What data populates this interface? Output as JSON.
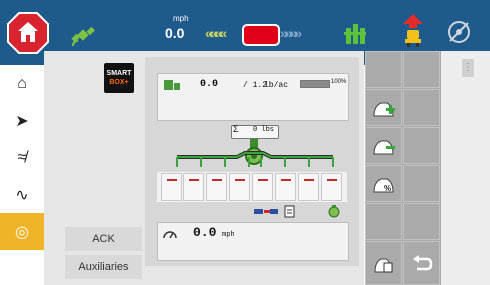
{
  "top_bar": {
    "speed_unit": "mph",
    "speed_value": "0.0",
    "steer_left": "««««",
    "steer_right": "»»»»",
    "icons": [
      "home-icon",
      "gps-satellite-icon",
      "boom-icon",
      "operator-seat-icon",
      "steering-wheel-disabled-icon"
    ],
    "colors": {
      "bar": "#1f5a8c",
      "home": "#d9232e",
      "alert": "#e0001a"
    }
  },
  "sidebar": {
    "items": [
      {
        "name": "home",
        "icon": "⌂"
      },
      {
        "name": "run",
        "icon": "➤"
      },
      {
        "name": "field",
        "icon": "≉"
      },
      {
        "name": "signal",
        "icon": "∿"
      },
      {
        "name": "settings",
        "icon": "◎"
      }
    ],
    "active_color": "#f0b428"
  },
  "smartbox": {
    "line1": "SMART",
    "line2": "BOX+"
  },
  "rate": {
    "value": "0.0",
    "target": "/ 1.2",
    "unit": "lb/ac",
    "tank_percent": "100%"
  },
  "total": {
    "sigma": "Σ",
    "value": "0 lbs"
  },
  "sections": {
    "count": 8
  },
  "speed": {
    "value": "0.0",
    "unit": "mph"
  },
  "buttons": {
    "ack": "ACK",
    "auxiliaries": "Auxiliaries"
  },
  "right_panel": {
    "increase": "+",
    "decrease": "−",
    "percent": "%",
    "menu": "⋮"
  }
}
